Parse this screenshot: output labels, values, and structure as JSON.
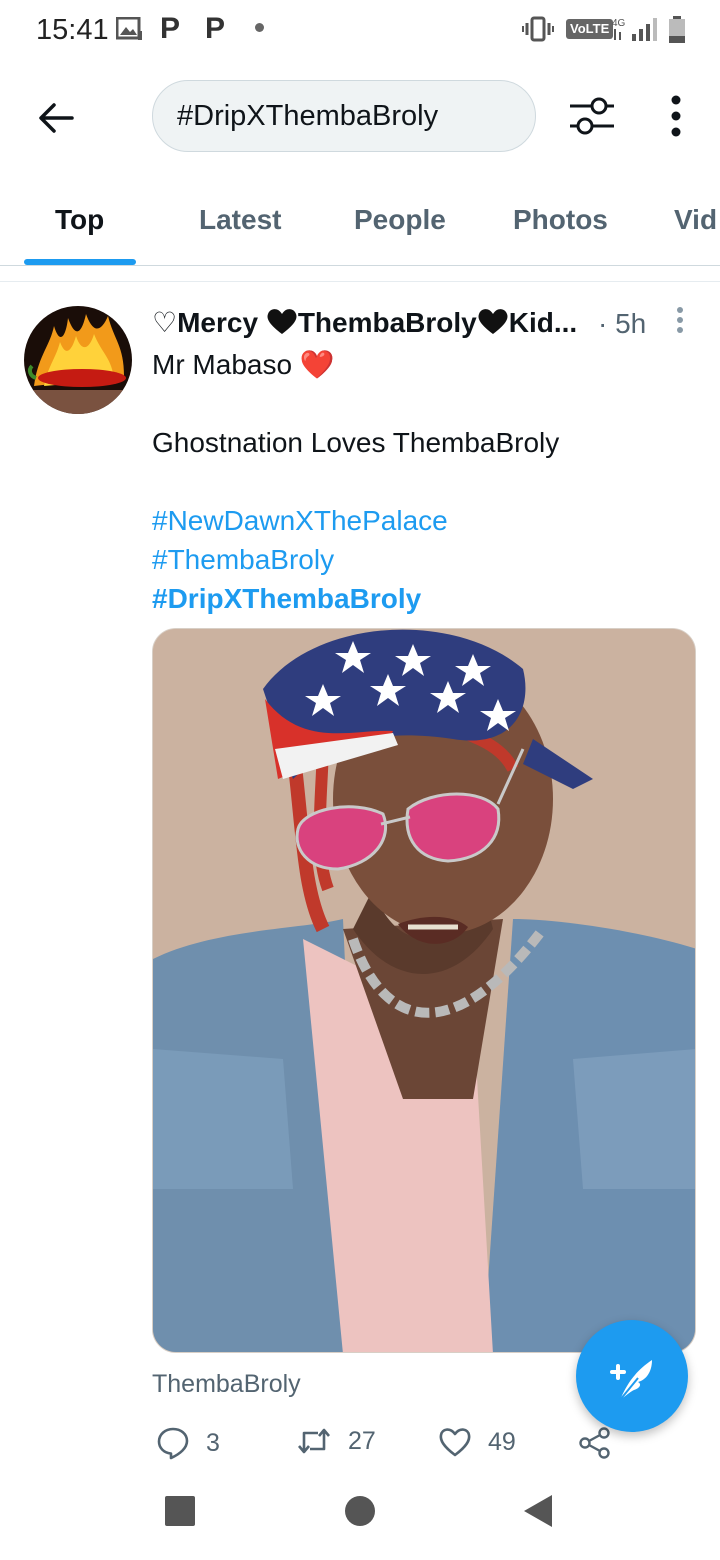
{
  "status_bar": {
    "time": "15:41",
    "p1": "P",
    "p2": "P",
    "volte": "VoLTE"
  },
  "search": {
    "query": "#DripXThembaBroly"
  },
  "tabs": [
    {
      "label": "Top",
      "active": true
    },
    {
      "label": "Latest",
      "active": false
    },
    {
      "label": "People",
      "active": false
    },
    {
      "label": "Photos",
      "active": false
    },
    {
      "label": "Vid",
      "active": false
    }
  ],
  "tweet": {
    "author_prefix": "♡Mercy ",
    "author_middle": "ThembaBroly",
    "author_suffix": "Kid...",
    "time": "· 5h",
    "text_line1": "Mr Mabaso ",
    "text_line1_emoji": "❤️",
    "text_line2": "Ghostnation Loves ThembaBroly",
    "hashtags": [
      "#NewDawnXThePalace",
      "#ThembaBroly",
      "#DripXThembaBroly"
    ],
    "media_caption": "ThembaBroly",
    "replies": "3",
    "retweets": "27",
    "likes": "49"
  },
  "colors": {
    "accent": "#1d9bf0",
    "text_primary": "#0f1419",
    "text_secondary": "#536471",
    "heart_red": "#e0245e"
  },
  "icons": {
    "back": "arrow-left-icon",
    "filter": "sliders-icon",
    "more": "vertical-dots-icon",
    "reply": "speech-bubble-icon",
    "retweet": "retweet-icon",
    "like": "heart-icon",
    "share": "share-icon",
    "compose": "compose-feather-icon"
  }
}
